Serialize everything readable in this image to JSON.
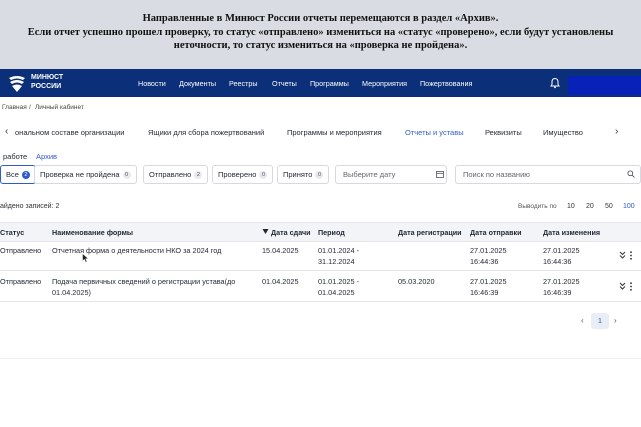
{
  "note": {
    "line1": "Направленные в Минюст России отчеты перемещаются в раздел «Архив».",
    "line2": "Если отчет успешно прошел проверку, то статус «отправлено» измениться на «статус «проверено», если будут установлены",
    "line3": "неточности, то статус измениться на «проверка не пройдена»."
  },
  "header": {
    "logo_line1": "МИНЮСТ",
    "logo_line2": "РОССИИ",
    "nav": [
      "Новости",
      "Документы",
      "Реестры",
      "Отчеты",
      "Программы",
      "Мероприятия",
      "Пожертвования"
    ]
  },
  "breadcrumb": {
    "home": "Главная",
    "sep": "/",
    "current": "Личный кабинет"
  },
  "tabs": [
    "ональном составе организации",
    "Ящики для сбора пожертвований",
    "Программы и мероприятия",
    "Отчеты и уставы",
    "Реквизиты",
    "Имущество"
  ],
  "subtabs": {
    "work": "работе",
    "archive": "Архив"
  },
  "filters": [
    {
      "label": "Все",
      "count": "2"
    },
    {
      "label": "Проверка не пройдена",
      "count": "0"
    },
    {
      "label": "Отправлено",
      "count": "2"
    },
    {
      "label": "Проверено",
      "count": "0"
    },
    {
      "label": "Принято",
      "count": "0"
    }
  ],
  "date_placeholder": "Выберите дату",
  "search_placeholder": "Поиск по названию",
  "found": "айдено записей: 2",
  "per_page": {
    "label": "Выводить по",
    "options": [
      "10",
      "20",
      "50",
      "100"
    ],
    "selected": "100"
  },
  "table": {
    "headers": [
      "Статус",
      "Наименование формы",
      "Дата сдачи",
      "Период",
      "Дата регистрации",
      "Дата отправки",
      "Дата изменения"
    ],
    "rows": [
      {
        "status": "Отправлено",
        "name": "Отчетная форма о деятельности НКО за 2024 год",
        "due": "15.04.2025",
        "period1": "01.01.2024 -",
        "period2": "31.12.2024",
        "reg": "",
        "sent1": "27.01.2025",
        "sent2": "16:44:36",
        "mod1": "27.01.2025",
        "mod2": "16:44:36"
      },
      {
        "status": "Отправлено",
        "name": "Подача первичных сведений о регистрации устава(до",
        "name2": "01.04.2025)",
        "due": "01.04.2025",
        "period1": "01.01.2025 -",
        "period2": "01.04.2025",
        "reg": "05.03.2020",
        "sent1": "27.01.2025",
        "sent2": "16:46:39",
        "mod1": "27.01.2025",
        "mod2": "16:46:39"
      }
    ]
  },
  "pagination": {
    "current": "1"
  },
  "colors": {
    "header_bg": "#0b2f78",
    "accent": "#2f5bc8",
    "note_bg": "#d9dde3"
  }
}
